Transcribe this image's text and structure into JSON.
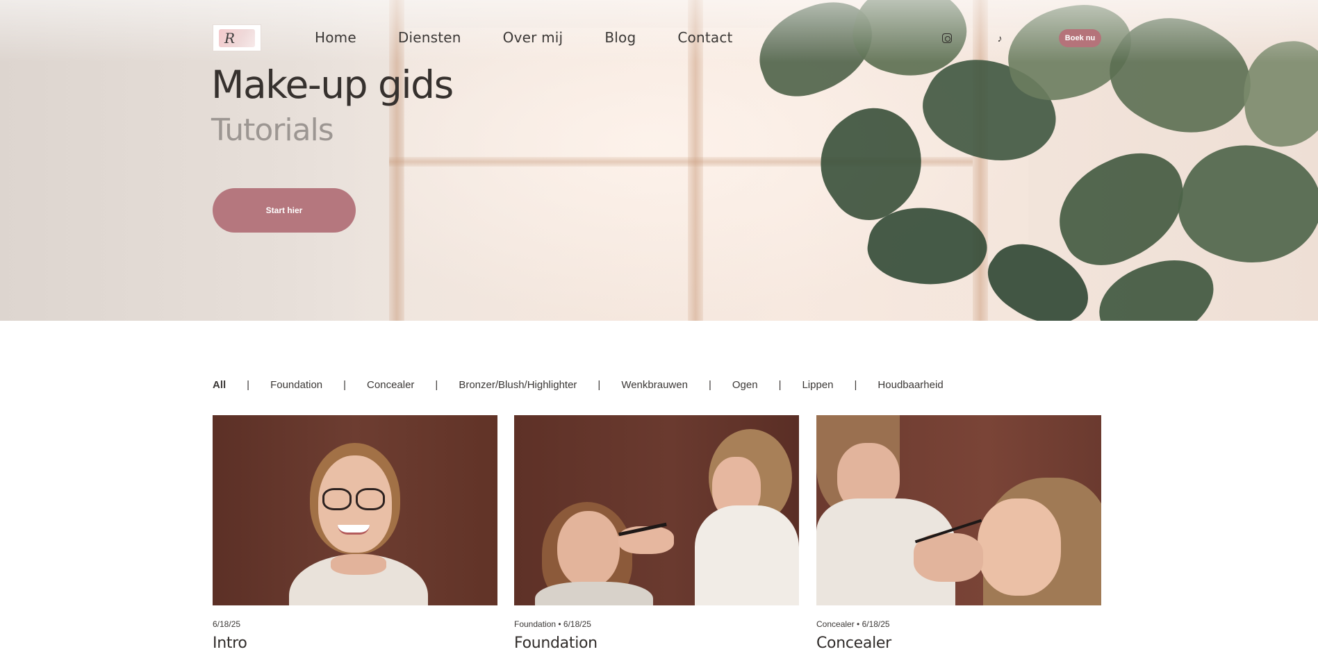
{
  "nav": {
    "logo_alt": "logo",
    "links": [
      "Home",
      "Diensten",
      "Over mij",
      "Blog",
      "Contact"
    ],
    "instagram_icon": "instagram-icon",
    "tiktok_icon": "tiktok-icon",
    "tiktok_glyph": "♪",
    "book_label": "Boek nu"
  },
  "hero": {
    "title": "Make-up gids",
    "subtitle": "Tutorials",
    "cta_label": "Start hier"
  },
  "filters": {
    "items": [
      "All",
      "Foundation",
      "Concealer",
      "Bronzer/Blush/Highlighter",
      "Wenkbrauwen",
      "Ogen",
      "Lippen",
      "Houdbaarheid"
    ],
    "separator": "|",
    "active": "All"
  },
  "posts": [
    {
      "meta": "6/18/25",
      "title": "Intro"
    },
    {
      "meta": "Foundation • 6/18/25",
      "title": "Foundation"
    },
    {
      "meta": "Concealer • 6/18/25",
      "title": "Concealer"
    }
  ],
  "colors": {
    "accent": "#b5777e",
    "text": "#3a3735",
    "muted": "#9c9692",
    "photo_bg": "#6a3a2e"
  }
}
